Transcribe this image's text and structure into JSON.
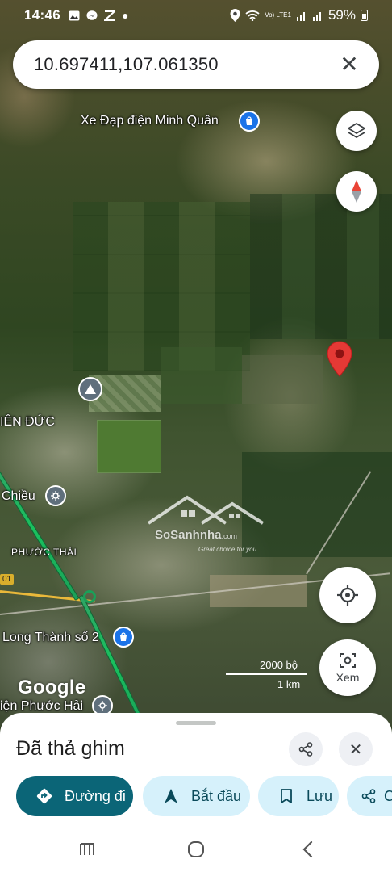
{
  "status_bar": {
    "time": "14:46",
    "battery": "59%",
    "network_label": "Vo) LTE1"
  },
  "search": {
    "query": "10.697411,107.061350",
    "close_icon": "close-icon"
  },
  "map": {
    "labels": {
      "bike_shop": "Xe Đạp điện Minh Quân",
      "tien_duc": "IÊN ĐỨC",
      "chieu": "Chiều",
      "phuoc_thai": "PHƯỚC THÁI",
      "road_badge": "01",
      "long_thanh": "Long Thành số 2",
      "phuoc_hai": "iện Phước Hải"
    },
    "scale": {
      "top": "2000 bộ",
      "bottom": "1 km"
    },
    "google_logo": "Google",
    "locate_label": "Xem",
    "watermark": {
      "brand": "SoSanhnha",
      "domain": ".com",
      "tagline": "Great choice for you"
    },
    "pin_color": "#e53935"
  },
  "sheet": {
    "title": "Đã thả ghim",
    "chips": {
      "directions": "Đường đi",
      "start": "Bắt đầu",
      "save": "Lưu",
      "share": "C"
    }
  },
  "colors": {
    "primary_chip": "#0b6577",
    "secondary_chip": "#d6f1fb",
    "route": "#19c15e"
  }
}
